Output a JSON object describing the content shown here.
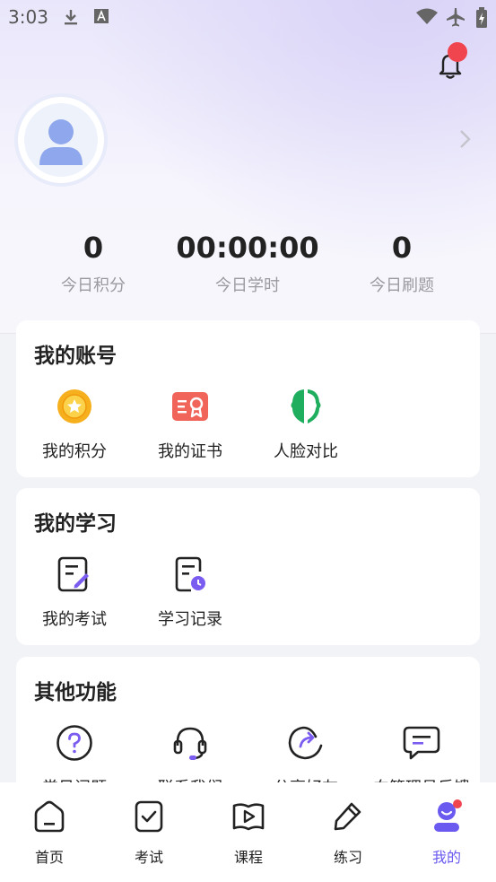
{
  "status_bar": {
    "time": "3:03"
  },
  "stats": [
    {
      "value": "0",
      "label": "今日积分"
    },
    {
      "value": "00:00:00",
      "label": "今日学时"
    },
    {
      "value": "0",
      "label": "今日刷题"
    }
  ],
  "account": {
    "title": "我的账号",
    "items": [
      {
        "label": "我的积分",
        "icon": "points-coin-icon"
      },
      {
        "label": "我的证书",
        "icon": "certificate-icon"
      },
      {
        "label": "人脸对比",
        "icon": "face-compare-icon"
      }
    ]
  },
  "study": {
    "title": "我的学习",
    "items": [
      {
        "label": "我的考试",
        "icon": "exam-edit-icon"
      },
      {
        "label": "学习记录",
        "icon": "study-record-icon"
      }
    ]
  },
  "other": {
    "title": "其他功能",
    "items": [
      {
        "label": "常见问题",
        "icon": "question-icon"
      },
      {
        "label": "联系我们",
        "icon": "headset-icon"
      },
      {
        "label": "分享好友",
        "icon": "share-icon"
      },
      {
        "label": "向管理员反馈",
        "icon": "feedback-icon"
      }
    ]
  },
  "tabs": [
    {
      "label": "首页",
      "icon": "home-icon"
    },
    {
      "label": "考试",
      "icon": "exam-icon"
    },
    {
      "label": "课程",
      "icon": "course-icon"
    },
    {
      "label": "练习",
      "icon": "practice-icon"
    },
    {
      "label": "我的",
      "icon": "profile-icon",
      "active": true
    }
  ],
  "colors": {
    "accent": "#6a5af0",
    "badge": "#f0454f",
    "coin": "#f6b01e",
    "cert": "#f0645a",
    "face": "#1fae5e"
  }
}
